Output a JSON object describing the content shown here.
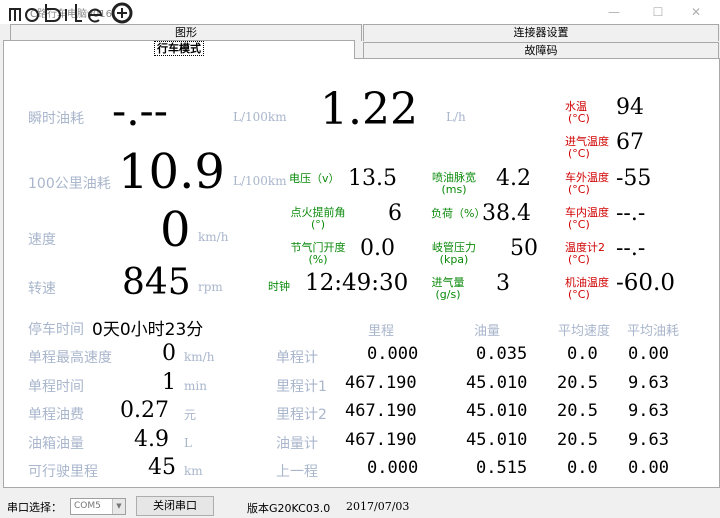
{
  "window": {
    "title": "C路行车电脑v016",
    "logo_text": "mobile",
    "minimize": "—",
    "maximize": "☐",
    "close": "✕"
  },
  "tabs": {
    "row1": [
      "图形",
      "连接器设置"
    ],
    "row2": [
      "行车模式",
      "故障码"
    ],
    "active": "行车模式"
  },
  "main": {
    "instant_fuel": {
      "label": "瞬时油耗",
      "value": "-.--",
      "unit": "L/100km"
    },
    "fuel_per_100km": {
      "label": "100公里油耗",
      "value": "10.9",
      "unit": "L/100km"
    },
    "speed": {
      "label": "速度",
      "value": "0",
      "unit": "km/h"
    },
    "rpm": {
      "label": "转速",
      "value": "845",
      "unit": "rpm"
    },
    "hourly_fuel": {
      "value": "1.22",
      "unit": "L/h"
    },
    "clock": {
      "label": "时钟",
      "value": "12:49:30"
    }
  },
  "sensors": {
    "voltage": {
      "label": "电压（v）",
      "value": "13.5"
    },
    "injection_width": {
      "label": "喷油脉宽",
      "sub": "(ms)",
      "value": "4.2"
    },
    "ignition_advance": {
      "label": "点火提前角",
      "sub": "(°)",
      "value": "6"
    },
    "load": {
      "label": "负荷（%）",
      "value": "38.4"
    },
    "throttle": {
      "label": "节气门开度",
      "sub": "(%)",
      "value": "0.0"
    },
    "manifold_pressure": {
      "label": "岐管压力",
      "sub": "(kpa)",
      "value": "50"
    },
    "intake_flow": {
      "label": "进气量",
      "sub": "(g/s)",
      "value": "3"
    }
  },
  "temps": {
    "water": {
      "label": "水温",
      "sub": "(°C)",
      "value": "94"
    },
    "intake": {
      "label": "进气温度",
      "sub": "(°C)",
      "value": "67"
    },
    "outside": {
      "label": "车外温度",
      "sub": "(°C)",
      "value": "-55"
    },
    "inside": {
      "label": "车内温度",
      "sub": "(°C)",
      "value": "--.-"
    },
    "temp2": {
      "label": "温度计2",
      "sub": "(°C)",
      "value": "--.-"
    },
    "oil": {
      "label": "机油温度",
      "sub": "(°C)",
      "value": "-60.0"
    }
  },
  "trip": {
    "stop_time": {
      "label": "停车时间",
      "value": "0天0小时23分"
    },
    "max_speed": {
      "label": "单程最高速度",
      "value": "0",
      "unit": "km/h"
    },
    "trip_time": {
      "label": "单程时间",
      "value": "1",
      "unit": "min"
    },
    "trip_cost": {
      "label": "单程油费",
      "value": "0.27",
      "unit": "元"
    },
    "tank": {
      "label": "油箱油量",
      "value": "4.9",
      "unit": "L"
    },
    "range": {
      "label": "可行驶里程",
      "value": "45",
      "unit": "km"
    }
  },
  "table": {
    "headers": [
      "里程",
      "油量",
      "平均速度",
      "平均油耗"
    ],
    "rows": [
      {
        "label": "单程计",
        "cells": [
          "0.000",
          "0.035",
          "0.0",
          "0.00"
        ]
      },
      {
        "label": "里程计1",
        "cells": [
          "467.190",
          "45.010",
          "20.5",
          "9.63"
        ]
      },
      {
        "label": "里程计2",
        "cells": [
          "467.190",
          "45.010",
          "20.5",
          "9.63"
        ]
      },
      {
        "label": "油量计",
        "cells": [
          "467.190",
          "45.010",
          "20.5",
          "9.63"
        ]
      },
      {
        "label": "上一程",
        "cells": [
          "0.000",
          "0.515",
          "0.0",
          "0.00"
        ]
      }
    ]
  },
  "status": {
    "port_label": "串口选择：",
    "port_value": "COM5",
    "close_port_button": "关闭串口",
    "version": "版本G20KC03.0",
    "date": "2017/07/03"
  },
  "colors": {
    "label_gray": "#a9b6cc",
    "sensor_label_green": "#0a8a0a",
    "temp_label_red": "#d00000"
  }
}
